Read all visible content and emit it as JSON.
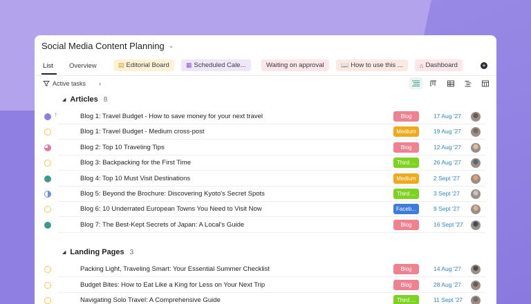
{
  "header": {
    "title": "Social Media Content Planning"
  },
  "tabs": {
    "list": "List",
    "overview": "Overview",
    "chips": [
      {
        "label": "Editorial Board",
        "icon": "board-icon",
        "bg": "#fdf2d6",
        "ic": "#d29a18",
        "glyph": "▤"
      },
      {
        "label": "Scheduled Cale...",
        "icon": "calendar-icon",
        "bg": "#efe7f8",
        "ic": "#8a5cc7",
        "glyph": "▦"
      },
      {
        "label": "Waiting on approval",
        "icon": "",
        "bg": "#fbe6ea",
        "ic": "#c2476a",
        "glyph": ""
      },
      {
        "label": "How to use this ...",
        "icon": "book-icon",
        "bg": "#fbe9e3",
        "ic": "#c8784f",
        "glyph": "📖"
      },
      {
        "label": "Dashboard",
        "icon": "home-icon",
        "bg": "#fbe6ea",
        "ic": "#d2456d",
        "glyph": "⌂"
      }
    ]
  },
  "toolbar": {
    "filter_label": "Active tasks"
  },
  "sections": [
    {
      "name": "Articles",
      "count": "8",
      "rows": [
        {
          "task": "Blog 1: Travel Budget - How to save money for your next travel",
          "tag": "Blog",
          "tag_color": "#ee8291",
          "date": "17 Aug '27",
          "status_color": "#8b7fe0",
          "status_type": "filled",
          "priority": true
        },
        {
          "task": "Blog 1: Travel Budget - Medium cross-post",
          "tag": "Medium",
          "tag_color": "#f0a91c",
          "date": "19 Aug '27",
          "status_color": "#f0c84a",
          "status_type": "ring",
          "priority": false
        },
        {
          "task": "Blog 2: Top 10 Traveling Tips",
          "tag": "Blog",
          "tag_color": "#ee8291",
          "date": "12 Aug '27",
          "status_color": "#e07aa0",
          "status_type": "partial",
          "priority": false
        },
        {
          "task": "Blog 3: Backpacking for the First Time",
          "tag": "Third ...",
          "tag_color": "#7ed321",
          "date": "26 Aug '27",
          "status_color": "#f0c84a",
          "status_type": "ring",
          "priority": false
        },
        {
          "task": "Blog 4: Top 10 Must Visit Destinations",
          "tag": "Medium",
          "tag_color": "#f0a91c",
          "date": "2 Sept '27",
          "status_color": "#3e9a8a",
          "status_type": "filled",
          "priority": false
        },
        {
          "task": "Blog 5: Beyond the Brochure: Discovering Kyoto's Secret Spots",
          "tag": "Third ...",
          "tag_color": "#7ed321",
          "date": "3 Sept '27",
          "status_color": "#6d8fe0",
          "status_type": "half",
          "priority": false
        },
        {
          "task": "Blog 6: 10 Underrated European Towns You Need to Visit Now",
          "tag": "Faceb...",
          "tag_color": "#3d7bdc",
          "date": "9 Sept '27",
          "status_color": "#f0c84a",
          "status_type": "ring",
          "priority": false
        },
        {
          "task": "Blog 7: The Best-Kept Secrets of Japan: A Local's Guide",
          "tag": "Blog",
          "tag_color": "#ee8291",
          "date": "16 Sept '27",
          "status_color": "#3e9a8a",
          "status_type": "filled",
          "priority": false
        }
      ]
    },
    {
      "name": "Landing Pages",
      "count": "3",
      "rows": [
        {
          "task": "Packing Light, Traveling Smart: Your Essential Summer Checklist",
          "tag": "Blog",
          "tag_color": "#ee8291",
          "date": "14 Aug '27",
          "status_color": "#f0c84a",
          "status_type": "ring",
          "priority": false
        },
        {
          "task": "Budget Bites: How to Eat Like a King for Less on Your Next Trip",
          "tag": "Blog",
          "tag_color": "#ee8291",
          "date": "28 Aug '27",
          "status_color": "#f0c84a",
          "status_type": "ring",
          "priority": false
        },
        {
          "task": "Navigating Solo Travel: A Comprehensive Guide",
          "tag": "Third ...",
          "tag_color": "#7ed321",
          "date": "11 Sept '27",
          "status_color": "#f0c84a",
          "status_type": "ring",
          "priority": false
        }
      ]
    }
  ]
}
